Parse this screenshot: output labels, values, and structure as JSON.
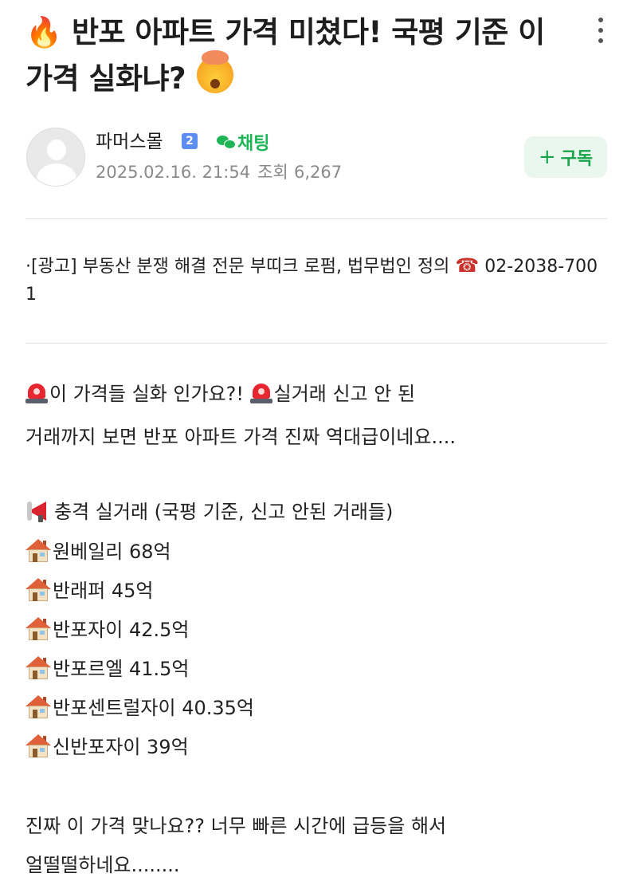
{
  "post": {
    "title_emoji_fire": "🔥",
    "title": "반포 아파트 가격 미쳤다! 국평 기준 이 가격 실화냐?",
    "title_emoji_shock": "🤯"
  },
  "author": {
    "name": "파머스몰",
    "level": "2",
    "chat_label": "채팅",
    "date": "2025.02.16. 21:54",
    "views_label": "조회",
    "views": "6,267",
    "subscribe_label": "구독",
    "subscribe_plus": "+"
  },
  "ad": {
    "text_before": "·[광고] 부동산 분쟁 해결 전문 부띠크 로펌, 법무법인 정의 ",
    "phone_icon": "☎",
    "phone": "02-2038-7001"
  },
  "body": {
    "line1_a": "이 가격들 실화 인가요?! ",
    "line1_b": "실거래 신고 안 된",
    "line2": "거래까지 보면 반포 아파트 가격 진짜 역대급이네요....",
    "heading": "충격 실거래 (국평 기준, 신고 안된 거래들)",
    "listings": [
      "원베일리 68억",
      "반래퍼 45억",
      "반포자이 42.5억",
      "반포르엘 41.5억",
      "반포센트럴자이 40.35억",
      "신반포자이 39억"
    ],
    "closing1": "진짜 이 가격 맞나요?? 너무 빠른 시간에 급등을 해서",
    "closing2": "얼떨떨하네요........"
  },
  "icons": {
    "more": "more-vertical-icon",
    "siren": "rotating-light-icon",
    "megaphone": "megaphone-icon",
    "house": "house-icon",
    "chat": "chat-bubble-icon"
  },
  "colors": {
    "accent_green": "#1eb556",
    "subscribe_bg": "#e9f7ee",
    "meta_gray": "#8a8a8a",
    "badge_blue": "#5b8ef0"
  }
}
